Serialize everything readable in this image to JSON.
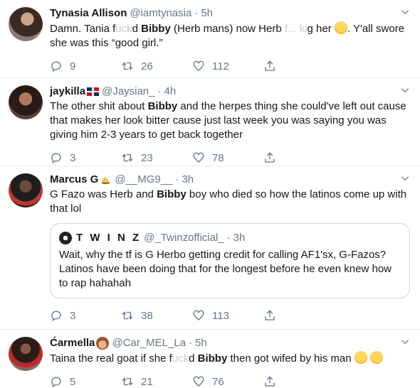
{
  "tweets": [
    {
      "name": "Tynasia Allison",
      "handle": "@iamtynasia",
      "dot": "·",
      "time": "5h",
      "text_a": "Damn. Tania f",
      "text_smudge_a": "uck",
      "text_b": "d ",
      "bold": "Bibby",
      "text_c": " (Herb mans) now Herb ",
      "text_smudge_b": "f... ki",
      "text_d": "g her ",
      "text_e": ". Y'all swore she was this “good girl.”",
      "replies": "9",
      "retweets": "26",
      "likes": "112"
    },
    {
      "name": "jaykilla",
      "handle": "@Jaysian_",
      "dot": "·",
      "time": "4h",
      "text_a": "The other shit about ",
      "bold": "Bibby",
      "text_b": " and the herpes thing she could've left out cause that makes her look bitter cause just last week you was saying you was giving him 2-3 years to get back together",
      "replies": "3",
      "retweets": "23",
      "likes": "78"
    },
    {
      "name": "Marcus G",
      "handle": "@__MG9__",
      "dot": "·",
      "time": "3h",
      "text_a": "G Fazo was Herb and ",
      "bold": "Bibby",
      "text_b": " boy who died so how the latinos come up with that lol",
      "quote": {
        "name": "T W I N Z",
        "handle": "@_Twinzofficial_",
        "dot": "·",
        "time": "3h",
        "text": "Wait, why the tf is G Herbo getting credit for calling AF1'sx, G-Fazos? Latinos have been doing that for the longest before he even knew how to rap hahahah"
      },
      "replies": "3",
      "retweets": "38",
      "likes": "113"
    },
    {
      "name": "Ćarmella",
      "handle": "@Car_MEL_La",
      "dot": "·",
      "time": "5h",
      "text_a": "Taina the real goat if she f",
      "text_smudge_a": "uck",
      "text_b": "d ",
      "bold": "Bibby",
      "text_c": " then got wifed by his man ",
      "replies": "5",
      "retweets": "21",
      "likes": "76"
    }
  ],
  "icons": {
    "reply": "reply-icon",
    "retweet": "retweet-icon",
    "like": "heart-icon",
    "share": "share-icon",
    "more": "chevron-down-icon"
  },
  "colors": {
    "text": "#14171a",
    "muted": "#657786",
    "border": "#e6ecf0"
  }
}
